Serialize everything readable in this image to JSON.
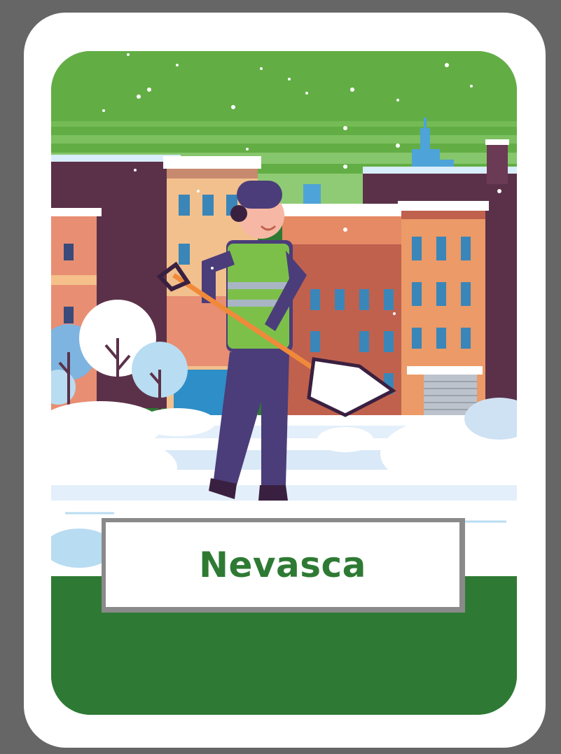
{
  "card": {
    "title": "Nevasca",
    "illustration": "snow-shoveling-city-scene",
    "colors": {
      "background": "#666666",
      "card": "#ffffff",
      "sky": "#5fae45",
      "ground": "#2e7a34",
      "title_text": "#2e7a34",
      "title_border": "#8a8a8a"
    }
  }
}
